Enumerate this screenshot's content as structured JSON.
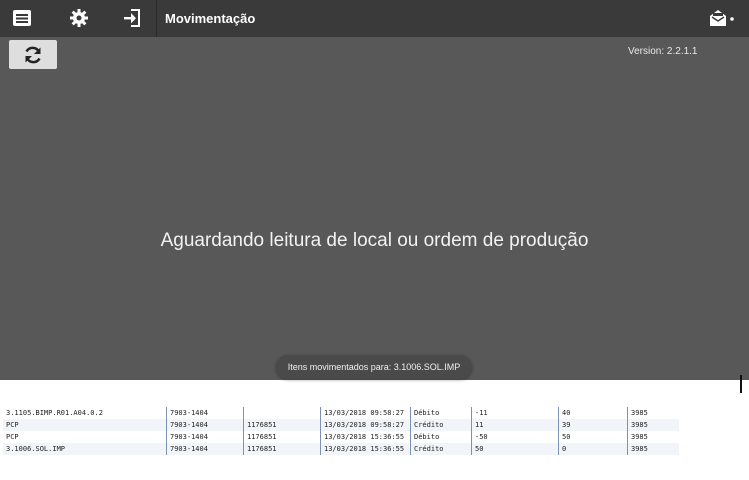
{
  "header": {
    "title": "Movimentação",
    "icons": [
      "menu-icon",
      "settings-gear-icon",
      "login-icon",
      "mail-notification-icon"
    ]
  },
  "main": {
    "version": "Version: 2.2.1.1",
    "waiting_message": "Aguardando leitura de local ou ordem de produção",
    "toast": "Itens movimentados para: 3.1006.SOL.IMP"
  },
  "table": {
    "rows": [
      [
        "3.1105.BIMP.R01.A04.0.2",
        "7903-1404",
        "",
        "13/03/2018 09:58:27",
        "Débito",
        "-11",
        "40",
        "3985"
      ],
      [
        "PCP",
        "7903-1404",
        "1176851",
        "13/03/2018 09:58:27",
        "Crédito",
        "11",
        "39",
        "3985"
      ],
      [
        "PCP",
        "7903-1404",
        "1176851",
        "13/03/2018 15:36:55",
        "Débito",
        "-50",
        "50",
        "3985"
      ],
      [
        "3.1006.SOL.IMP",
        "7903-1404",
        "1176851",
        "13/03/2018 15:36:55",
        "Crédito",
        "50",
        "0",
        "3985"
      ]
    ]
  }
}
